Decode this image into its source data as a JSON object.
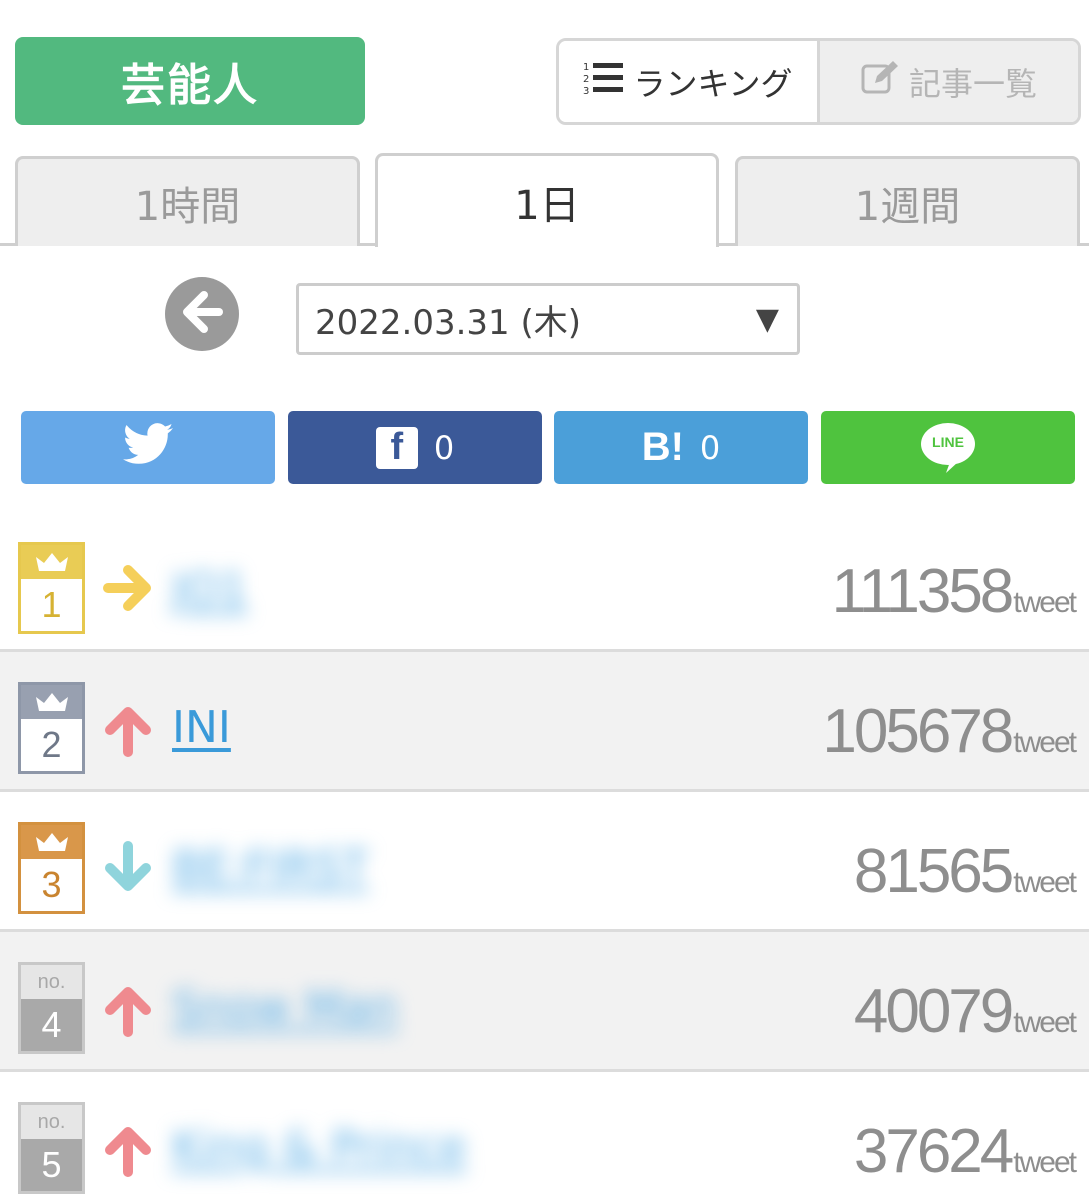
{
  "header": {
    "category_label": "芸能人",
    "view_switch": [
      {
        "label": "ランキング",
        "icon": "ranked-list-icon",
        "active": true
      },
      {
        "label": "記事一覧",
        "icon": "edit-icon",
        "active": false
      }
    ]
  },
  "tabs": [
    {
      "label": "1時間",
      "active": false
    },
    {
      "label": "1日",
      "active": true
    },
    {
      "label": "1週間",
      "active": false
    }
  ],
  "date_selector": {
    "value": "2022.03.31 (木)"
  },
  "share": {
    "twitter": {
      "icon": "twitter-bird-icon"
    },
    "facebook": {
      "logo": "f",
      "count": "0"
    },
    "hatena": {
      "logo": "B!",
      "count": "0"
    },
    "line": {
      "logo": "LINE"
    }
  },
  "ranking": [
    {
      "rank": "1",
      "badge": "gold",
      "trend": "right",
      "name": "JO1",
      "blurred": true,
      "score": "111358",
      "unit": "tweet"
    },
    {
      "rank": "2",
      "badge": "silver",
      "trend": "up",
      "name": "INI",
      "blurred": false,
      "score": "105678",
      "unit": "tweet"
    },
    {
      "rank": "3",
      "badge": "bronze",
      "trend": "down",
      "name": "BE:FIRST",
      "blurred": true,
      "score": "81565",
      "unit": "tweet"
    },
    {
      "rank": "4",
      "badge": "gray",
      "badge_prefix": "no.",
      "trend": "up",
      "name": "Snow Man",
      "blurred": true,
      "score": "40079",
      "unit": "tweet"
    },
    {
      "rank": "5",
      "badge": "gray",
      "badge_prefix": "no.",
      "trend": "up",
      "name": "King & Prince",
      "blurred": true,
      "score": "37624",
      "unit": "tweet"
    }
  ],
  "colors": {
    "category_green": "#52b97f",
    "twitter": "#66a8e8",
    "facebook": "#3b5998",
    "hatena": "#4b9fd9",
    "line": "#4fc33e",
    "trend_up": "#ef8a8f",
    "trend_down": "#8fd4dc",
    "trend_right": "#f5cf5a",
    "link": "#3a9ad9"
  }
}
